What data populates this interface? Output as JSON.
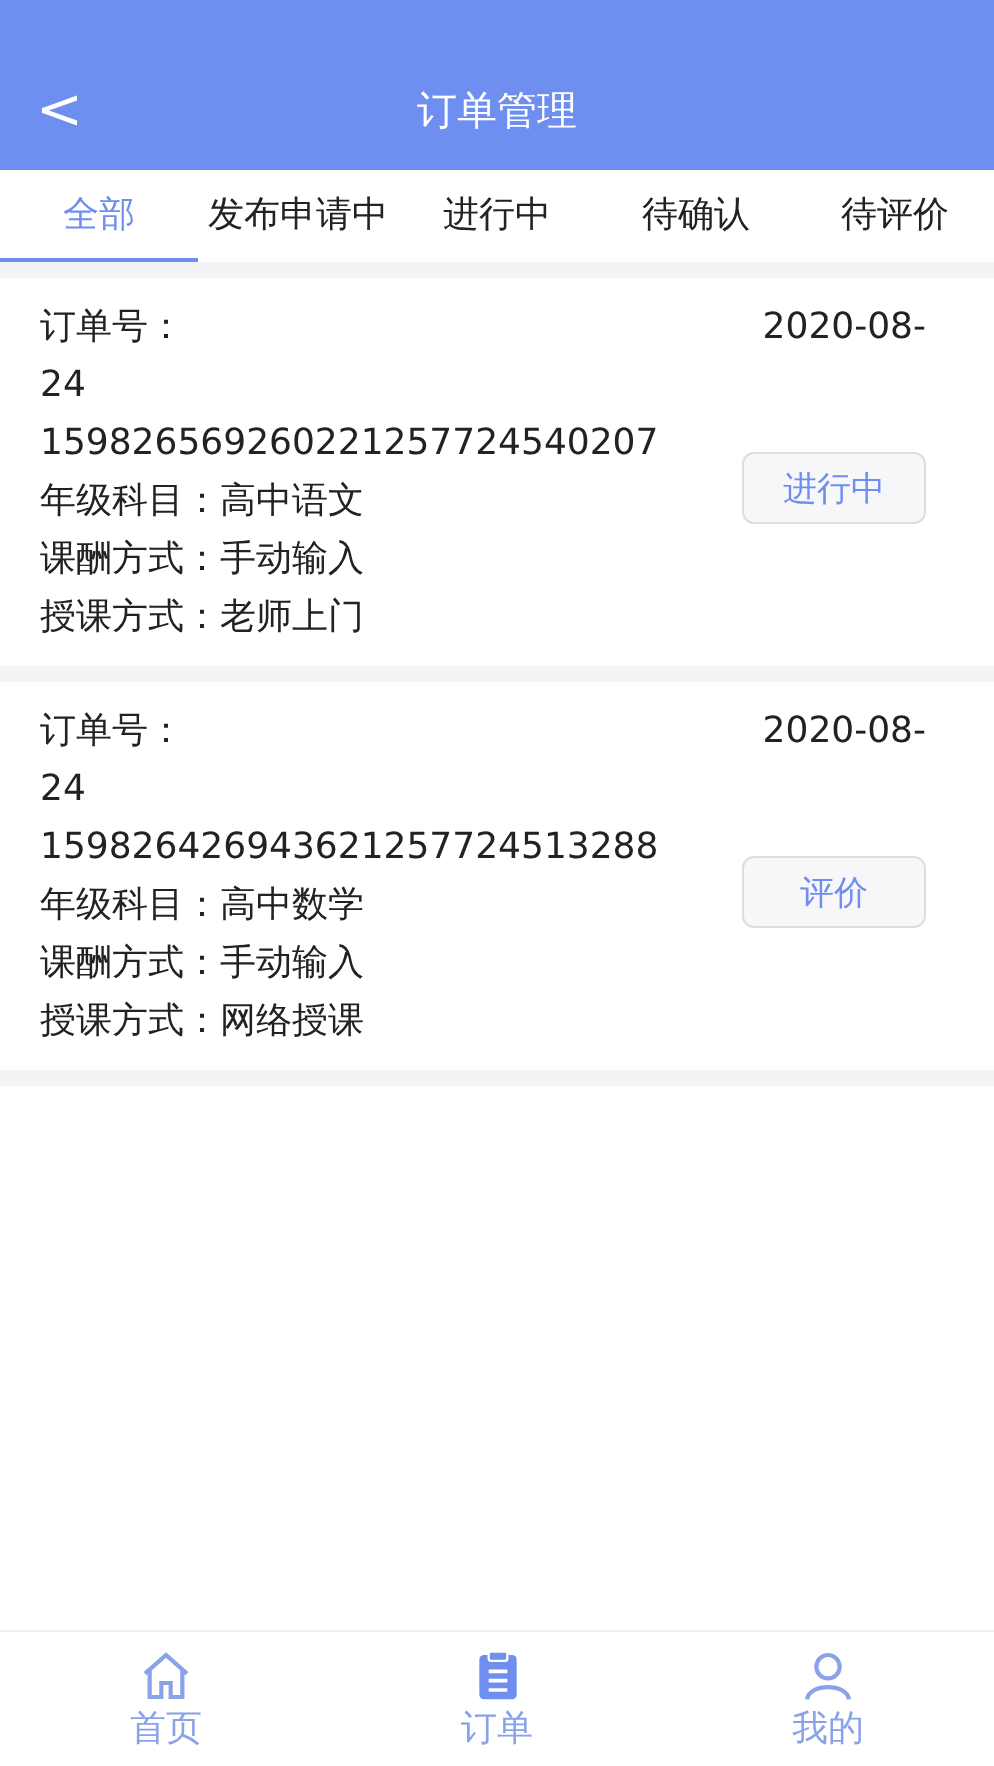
{
  "header": {
    "back": "<",
    "title": "订单管理"
  },
  "tabs": [
    {
      "label": "全部",
      "selected": true
    },
    {
      "label": "发布申请中",
      "selected": false
    },
    {
      "label": "进行中",
      "selected": false
    },
    {
      "label": "待确认",
      "selected": false
    },
    {
      "label": "待评价",
      "selected": false
    }
  ],
  "orders": [
    {
      "order_label": "订单号：",
      "date_parts": [
        "2020-08-",
        "24"
      ],
      "order_no": "159826569260221257724540207",
      "fields": [
        {
          "label": "年级科目：",
          "value": "高中语文"
        },
        {
          "label": "课酬方式：",
          "value": "手动输入"
        },
        {
          "label": "授课方式：",
          "value": "老师上门"
        }
      ],
      "action": "进行中"
    },
    {
      "order_label": "订单号：",
      "date_parts": [
        "2020-08-",
        "24"
      ],
      "order_no": "159826426943621257724513288",
      "fields": [
        {
          "label": "年级科目：",
          "value": "高中数学"
        },
        {
          "label": "课酬方式：",
          "value": "手动输入"
        },
        {
          "label": "授课方式：",
          "value": "网络授课"
        }
      ],
      "action": "评价"
    }
  ],
  "bottom_nav": [
    {
      "label": "首页",
      "kind": "home",
      "selected": false
    },
    {
      "label": "订单",
      "kind": "order",
      "selected": true
    },
    {
      "label": "我的",
      "kind": "me",
      "selected": false
    }
  ]
}
